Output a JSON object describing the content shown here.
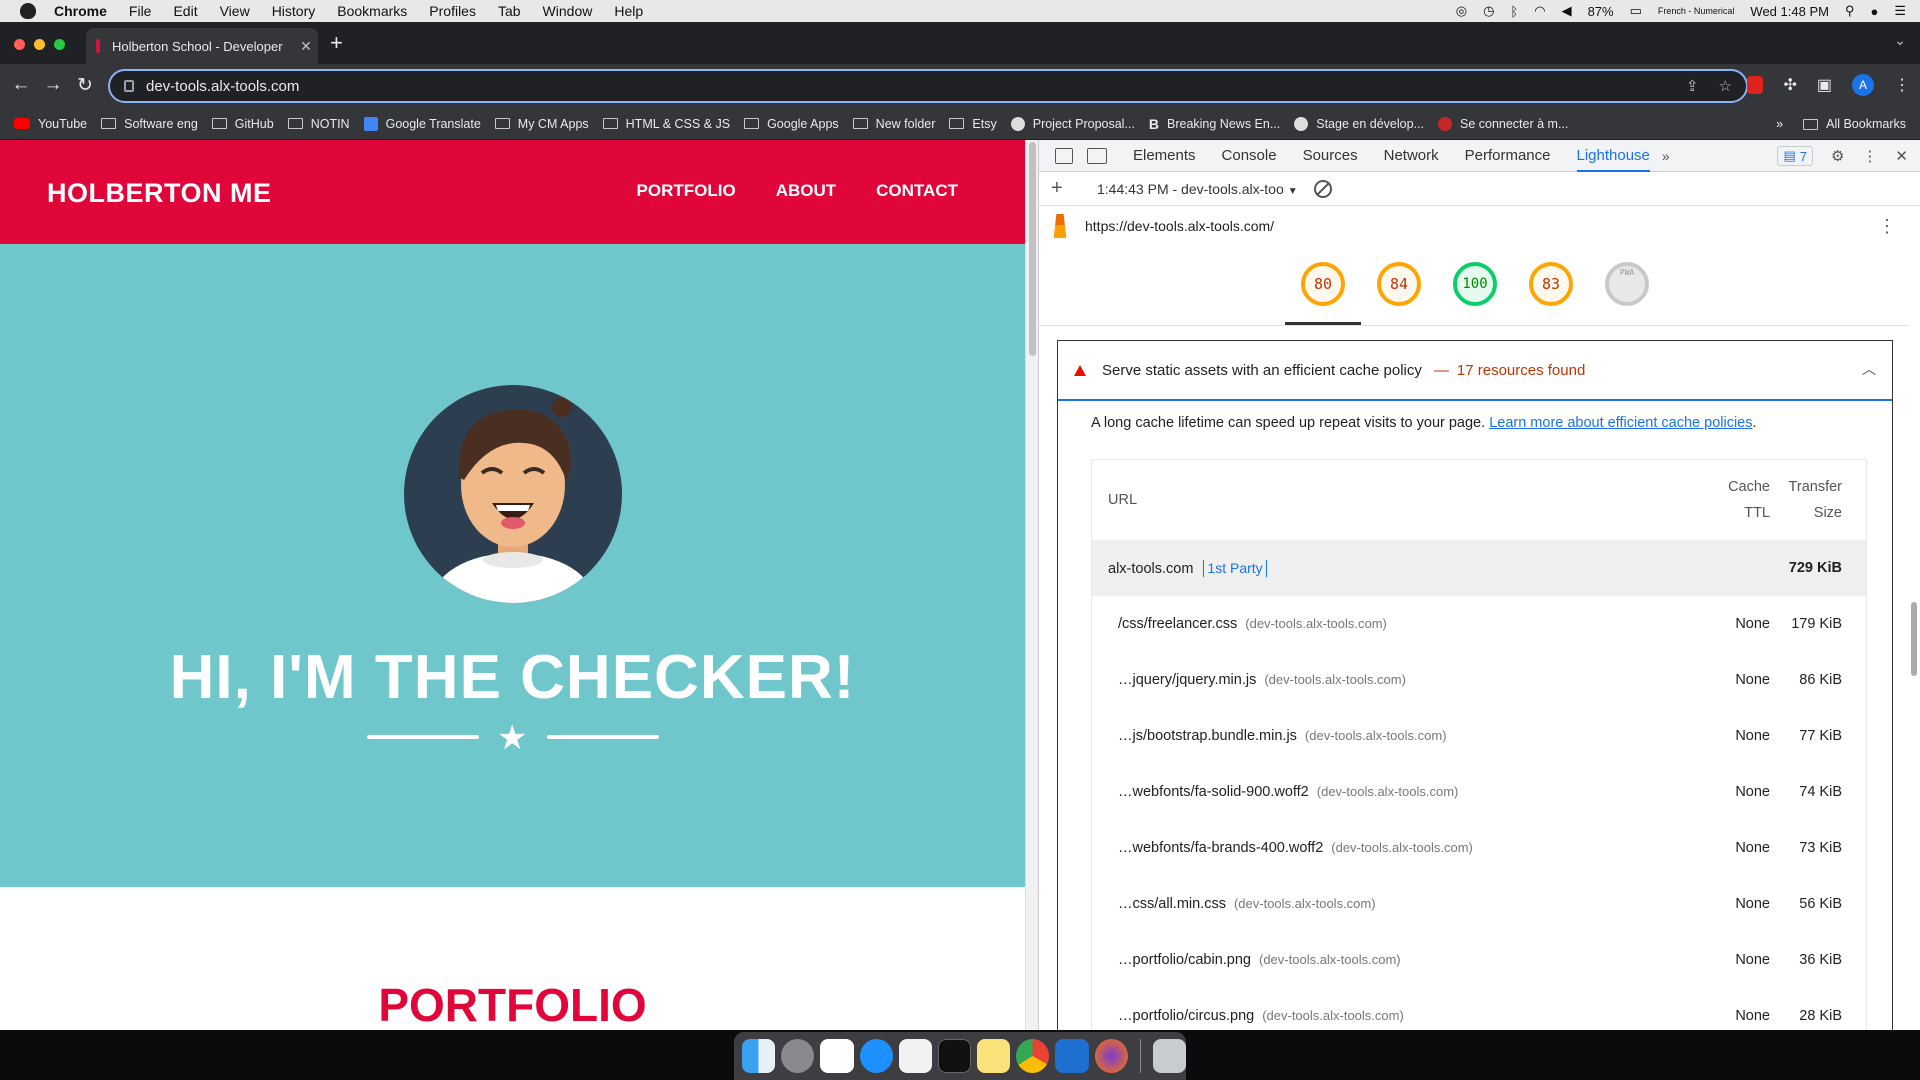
{
  "menubar": {
    "app": "Chrome",
    "items": [
      "File",
      "Edit",
      "View",
      "History",
      "Bookmarks",
      "Profiles",
      "Tab",
      "Window",
      "Help"
    ],
    "battery": "87%",
    "input_source": "French - Numerical",
    "clock": "Wed 1:48 PM"
  },
  "tab": {
    "title": "Holberton School - Developer",
    "close": "✕"
  },
  "address": {
    "url": "dev-tools.alx-tools.com"
  },
  "bookmarks": [
    "YouTube",
    "Software eng",
    "GitHub",
    "NOTIN",
    "Google Translate",
    "My CM Apps",
    "HTML & CSS & JS",
    "Google Apps",
    "New folder",
    "Etsy",
    "Project Proposal...",
    "Breaking News En...",
    "Stage en dévelop...",
    "Se connecter à m..."
  ],
  "all_bookmarks": "All Bookmarks",
  "site": {
    "brand": "HOLBERTON ME",
    "nav": [
      "PORTFOLIO",
      "ABOUT",
      "CONTACT"
    ],
    "hero_title": "HI, I'M THE CHECKER!",
    "section_title": "PORTFOLIO"
  },
  "devtools": {
    "tabs": [
      "Elements",
      "Console",
      "Sources",
      "Network",
      "Performance",
      "Lighthouse"
    ],
    "active_tab": "Lighthouse",
    "issues_count": "7",
    "report_label": "1:44:43 PM - dev-tools.alx-too",
    "report_url": "https://dev-tools.alx-tools.com/",
    "scores": [
      "80",
      "84",
      "100",
      "83"
    ],
    "score_na": "PWA",
    "audit": {
      "title": "Serve static assets with an efficient cache policy",
      "dash": "—",
      "found": "17 resources found",
      "desc_prefix": "A long cache lifetime can speed up repeat visits to your page. ",
      "desc_link": "Learn more about efficient cache policies",
      "desc_suffix": "."
    },
    "table": {
      "col_url": "URL",
      "col_ttl_1": "Cache",
      "col_ttl_2": "TTL",
      "col_size_1": "Transfer",
      "col_size_2": "Size",
      "group": {
        "name": "alx-tools.com",
        "badge": "1st Party",
        "size": "729 KiB"
      },
      "rows": [
        {
          "path": "/css/freelancer.css",
          "host": "(dev-tools.alx-tools.com)",
          "ttl": "None",
          "size": "179 KiB"
        },
        {
          "path": "…jquery/jquery.min.js",
          "host": "(dev-tools.alx-tools.com)",
          "ttl": "None",
          "size": "86 KiB"
        },
        {
          "path": "…js/bootstrap.bundle.min.js",
          "host": "(dev-tools.alx-tools.com)",
          "ttl": "None",
          "size": "77 KiB"
        },
        {
          "path": "…webfonts/fa-solid-900.woff2",
          "host": "(dev-tools.alx-tools.com)",
          "ttl": "None",
          "size": "74 KiB"
        },
        {
          "path": "…webfonts/fa-brands-400.woff2",
          "host": "(dev-tools.alx-tools.com)",
          "ttl": "None",
          "size": "73 KiB"
        },
        {
          "path": "…css/all.min.css",
          "host": "(dev-tools.alx-tools.com)",
          "ttl": "None",
          "size": "56 KiB"
        },
        {
          "path": "…portfolio/cabin.png",
          "host": "(dev-tools.alx-tools.com)",
          "ttl": "None",
          "size": "36 KiB"
        },
        {
          "path": "…portfolio/circus.png",
          "host": "(dev-tools.alx-tools.com)",
          "ttl": "None",
          "size": "28 KiB"
        }
      ]
    }
  },
  "colors": {
    "brand_red": "#e0063a",
    "masthead": "#6fc6cb",
    "accent_blue": "#1a73e8"
  }
}
